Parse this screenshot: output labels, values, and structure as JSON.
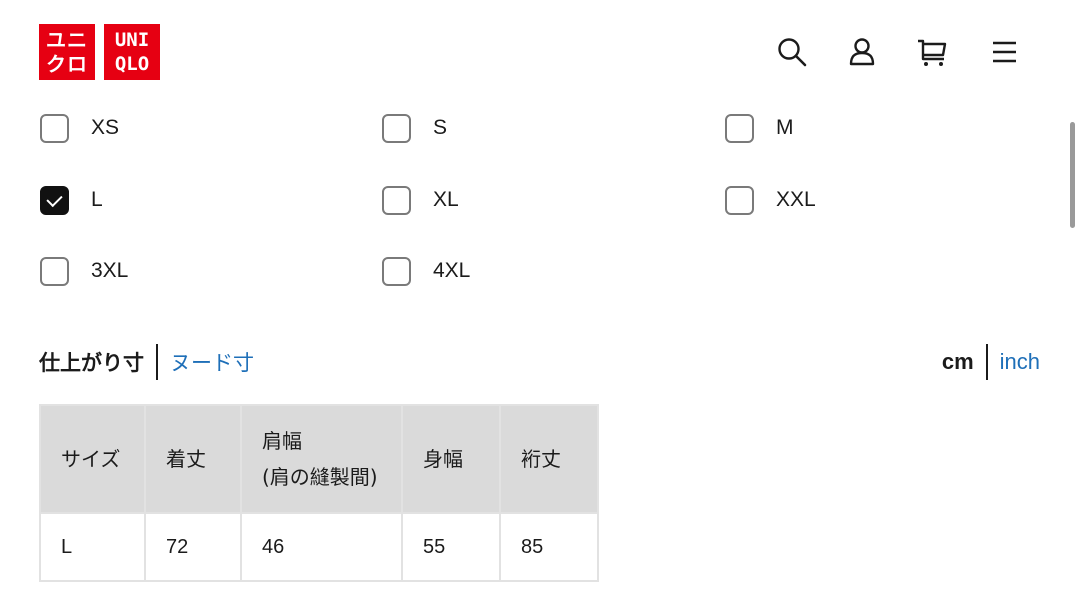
{
  "header": {
    "logo": {
      "jp_line1": "ユニ",
      "jp_line2": "クロ",
      "en_line1": "UNI",
      "en_line2": "QLO",
      "brand_color": "#e60012"
    },
    "icons": [
      "search-icon",
      "account-icon",
      "cart-icon",
      "menu-icon"
    ]
  },
  "sizes": {
    "options": [
      {
        "label": "XS",
        "checked": false
      },
      {
        "label": "S",
        "checked": false
      },
      {
        "label": "M",
        "checked": false
      },
      {
        "label": "L",
        "checked": true
      },
      {
        "label": "XL",
        "checked": false
      },
      {
        "label": "XXL",
        "checked": false
      },
      {
        "label": "3XL",
        "checked": false
      },
      {
        "label": "4XL",
        "checked": false
      }
    ]
  },
  "measure_tabs": {
    "active": "仕上がり寸",
    "other": "ヌード寸"
  },
  "units": {
    "active": "cm",
    "other": "inch",
    "link_color": "#1e6fb8"
  },
  "table": {
    "headers": [
      "サイズ",
      "着丈",
      "肩幅",
      "(肩の縫製間)",
      "身幅",
      "裄丈"
    ],
    "rows": [
      {
        "size": "L",
        "length": "72",
        "shoulder": "46",
        "chest": "55",
        "sleeve": "85"
      }
    ]
  }
}
